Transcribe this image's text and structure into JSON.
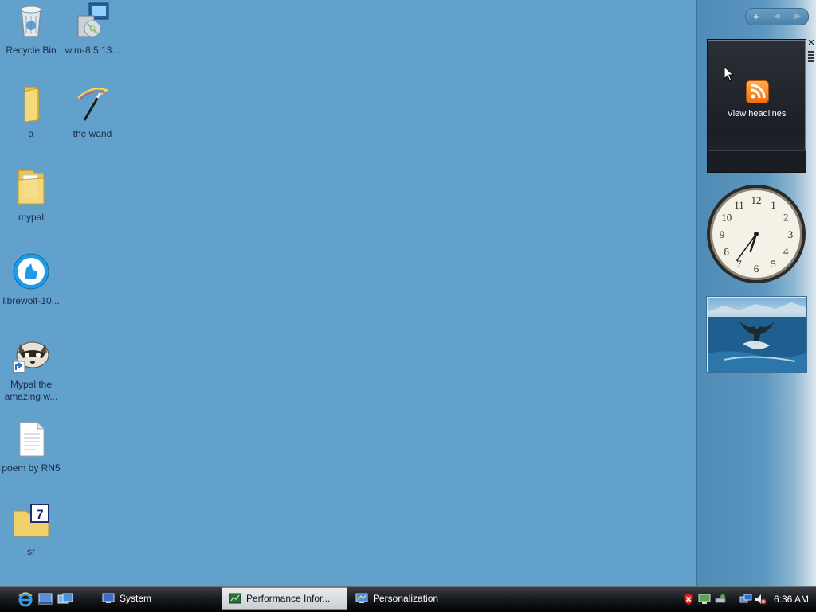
{
  "desktop": {
    "icons": [
      {
        "name": "Recycle Bin",
        "icon": "recycle-bin-icon"
      },
      {
        "name": "wlm-8.5.13...",
        "icon": "installer-icon"
      },
      {
        "name": "a",
        "icon": "folder-icon"
      },
      {
        "name": "the wand",
        "icon": "magic-wand-icon"
      },
      {
        "name": "mypal",
        "icon": "folder-icon"
      },
      {
        "name": "librewolf-10...",
        "icon": "librewolf-icon"
      },
      {
        "name": "Mypal the amazing w...",
        "icon": "raccoon-shortcut-icon"
      },
      {
        "name": "poem by RN5",
        "icon": "text-document-icon"
      },
      {
        "name": "sr",
        "icon": "folder-7z-icon"
      }
    ]
  },
  "sidebar": {
    "controls": {
      "add": "+",
      "prev": "◀",
      "next": "▶"
    },
    "feed_gadget": {
      "label": "View headlines"
    },
    "clock": {
      "hour": 6,
      "minute": 36,
      "numbers": [
        "12",
        "1",
        "2",
        "3",
        "4",
        "5",
        "6",
        "7",
        "8",
        "9",
        "10",
        "11"
      ]
    }
  },
  "taskbar": {
    "quicklaunch": [
      "internet-explorer-icon",
      "show-desktop-icon",
      "switch-windows-icon"
    ],
    "buttons": [
      {
        "label": "System",
        "active": false
      },
      {
        "label": "Performance Infor...",
        "active": true
      },
      {
        "label": "Personalization",
        "active": false
      }
    ],
    "tray": {
      "time": "6:36 AM"
    }
  }
}
